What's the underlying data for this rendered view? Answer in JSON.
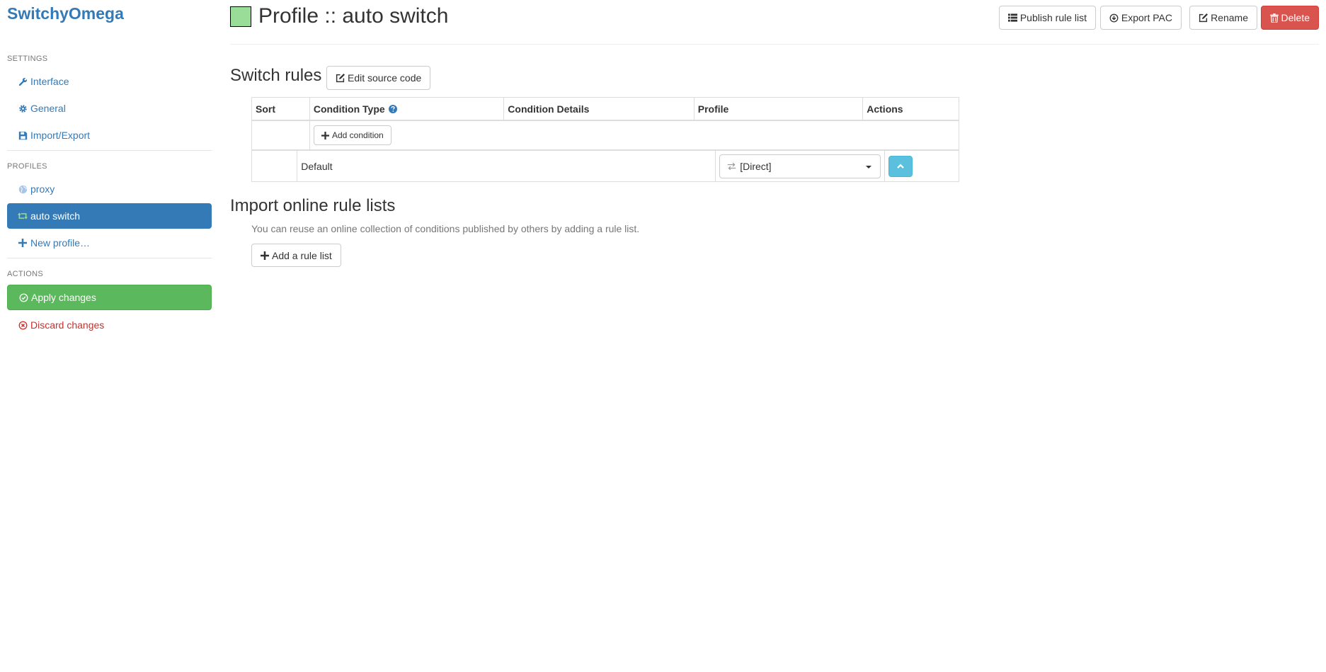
{
  "app": {
    "brand": "SwitchyOmega"
  },
  "sidebar": {
    "settings_header": "SETTINGS",
    "profiles_header": "PROFILES",
    "actions_header": "ACTIONS",
    "settings_items": [
      {
        "label": "Interface",
        "icon": "wrench-icon"
      },
      {
        "label": "General",
        "icon": "gear-icon"
      },
      {
        "label": "Import/Export",
        "icon": "floppy-icon"
      }
    ],
    "profile_items": [
      {
        "label": "proxy",
        "icon": "globe-icon"
      },
      {
        "label": "auto switch",
        "icon": "retweet-icon",
        "active": true
      },
      {
        "label": "New profile…",
        "icon": "plus-icon"
      }
    ],
    "action_items": [
      {
        "label": "Apply changes",
        "icon": "check-circle-icon"
      },
      {
        "label": "Discard changes",
        "icon": "x-circle-icon"
      }
    ]
  },
  "header": {
    "title": "Profile :: auto switch",
    "profile_color": "#99dd99",
    "buttons": {
      "publish": "Publish rule list",
      "export": "Export PAC",
      "rename": "Rename",
      "delete": "Delete"
    }
  },
  "switch_rules": {
    "title": "Switch rules",
    "edit_source_label": "Edit source code",
    "columns": [
      "Sort",
      "Condition Type",
      "Condition Details",
      "Profile",
      "Actions"
    ],
    "add_condition_label": "Add condition",
    "default_row": {
      "label": "Default",
      "profile": "[Direct]"
    }
  },
  "import_rules": {
    "title": "Import online rule lists",
    "help": "You can reuse an online collection of conditions published by others by adding a rule list.",
    "add_label": "Add a rule list"
  },
  "colors": {
    "primary": "#337ab7",
    "success": "#5cb85c",
    "danger": "#d9534f",
    "info": "#5bc0de"
  }
}
